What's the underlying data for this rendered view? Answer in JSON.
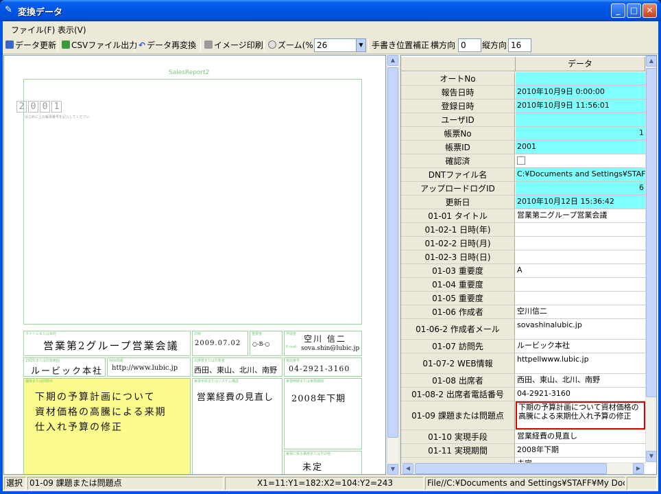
{
  "window": {
    "title": "変換データ"
  },
  "menu": [
    {
      "label": "ファイル(F)"
    },
    {
      "label": "表示(V)"
    }
  ],
  "toolbar": {
    "refresh_label": "データ更新",
    "csv_label": "CSVファイル出力",
    "reconvert_label": "データ再変換",
    "print_label": "イメージ印刷",
    "zoom_label": "ズーム(%)",
    "zoom_value": "26",
    "hand_adjust_label": "手書き位置補正",
    "horizontal_label": "横方向",
    "horizontal_value": "0",
    "vertical_label": "縦方向",
    "vertical_value": "16"
  },
  "form": {
    "title": "SalesReport2",
    "id_digits": [
      "2",
      "0",
      "0",
      "1"
    ],
    "hint": "はじめに上の帳票番号を記入してください",
    "captions": {
      "title_purpose": "タイトルまたは目的",
      "date": "日時",
      "importance": "重要度",
      "author": "作成者",
      "visit": "訪問先または対象範囲",
      "web": "Web情報",
      "attendees": "出席者または対象者",
      "phone": "電話番号",
      "issue": "課題または問題点",
      "method": "実現手段またはシステム構成",
      "period": "実現時期または実現期間",
      "related": "実現に係る費用またはその他"
    },
    "handwriting": {
      "title": "営業第2グループ営業会議",
      "date": "2009.07.02",
      "importance": "○-B-○",
      "author": "空川 信二",
      "email_label": "E-mail",
      "email": "sova.shin@lubic.jp",
      "visit": "ルービック本社",
      "web": "http://www.lubic.jp",
      "attendees": "西田、東山、北川、南野",
      "phone": "04-2921-3160",
      "issue_lines": [
        "下期の予算計画について",
        "資材価格の高騰による来期",
        "仕入れ予算の修正"
      ],
      "method": "営業経費の見直し",
      "period": "2008年下期",
      "related": "未定"
    }
  },
  "grid": {
    "header_data": "データ",
    "rows": [
      {
        "key": "オートNo",
        "value": "",
        "cyan": true
      },
      {
        "key": "報告日時",
        "value": "2010年10月9日  0:00:00",
        "cyan": true
      },
      {
        "key": "登録日時",
        "value": "2010年10月9日  11:56:01",
        "cyan": true
      },
      {
        "key": "ユーザID",
        "value": "",
        "cyan": true
      },
      {
        "key": "帳票No",
        "value": "1",
        "cyan": true,
        "right": true
      },
      {
        "key": "帳票ID",
        "value": "2001",
        "cyan": true
      },
      {
        "key": "確認済",
        "value": "",
        "checkbox": true
      },
      {
        "key": "DNTファイル名",
        "value": "C:¥Documents and Settings¥STAFF¥",
        "cyan": true
      },
      {
        "key": "アップロードログID",
        "value": "6",
        "cyan": true,
        "right": true
      },
      {
        "key": "更新日",
        "value": "2010年10月12日  15:36:42",
        "cyan": true
      },
      {
        "key": "01-01  タイトル",
        "value": "営業第二グループ営業会議"
      },
      {
        "key": "01-02-1  日時(年)",
        "value": ""
      },
      {
        "key": "01-02-2  日時(月)",
        "value": ""
      },
      {
        "key": "01-02-3  日時(日)",
        "value": ""
      },
      {
        "key": "01-03  重要度",
        "value": "A"
      },
      {
        "key": "01-04  重要度",
        "value": ""
      },
      {
        "key": "01-05  重要度",
        "value": ""
      },
      {
        "key": "01-06  作成者",
        "value": "空川信二"
      },
      {
        "key": "01-06-2  作成者メール",
        "value": "sovashinalubic.jp",
        "tall": true
      },
      {
        "key": "01-07  訪問先",
        "value": "ルービック本社"
      },
      {
        "key": "01-07-2  WEB情報",
        "value": "httpellwww.lubic.jp",
        "tall": true
      },
      {
        "key": "01-08  出席者",
        "value": "西田、東山、北川、南野"
      },
      {
        "key": "01-08-2  出席者電話番号",
        "value": "04-2921-3160"
      },
      {
        "key": "01-09  課題または問題点",
        "value": "下期の予算計画について資材価格の高騰による来期仕入れ予算の修正",
        "selected": true,
        "xtall": true
      },
      {
        "key": "01-10  実現手段",
        "value": "営業経費の見直し"
      },
      {
        "key": "01-11  実現期間",
        "value": "2008年下期"
      },
      {
        "key": "",
        "value": "未定"
      }
    ]
  },
  "status": {
    "mode": "選択",
    "field": "01-09  課題または問題点",
    "coords": "X1=11:Y1=182:X2=104:Y2=243",
    "path": "File//C:¥Documents and Settings¥STAFF¥My Document"
  }
}
